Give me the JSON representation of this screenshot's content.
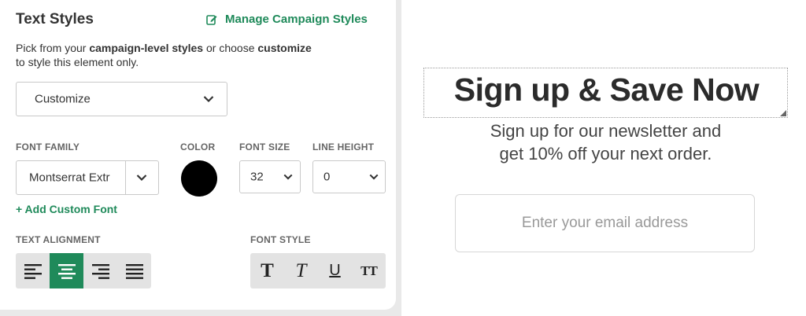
{
  "panel": {
    "title": "Text Styles",
    "manage_link": "Manage Campaign Styles",
    "description_parts": [
      "Pick from your ",
      "campaign-level styles",
      " or choose ",
      "customize",
      " to style this element only."
    ],
    "style_select": {
      "value": "Customize"
    },
    "labels": {
      "font_family": "FONT FAMILY",
      "color": "COLOR",
      "font_size": "FONT SIZE",
      "line_height": "LINE HEIGHT",
      "text_alignment": "TEXT ALIGNMENT",
      "font_style": "FONT STYLE"
    },
    "font_family_value": "Montserrat Extr",
    "color_value": "#000000",
    "font_size_value": "32",
    "line_height_value": "0",
    "add_font": "+ Add Custom Font",
    "alignment_options": [
      "align-left",
      "align-center",
      "align-right",
      "align-justify"
    ],
    "alignment_selected": "align-center",
    "font_style_options": [
      "bold",
      "italic",
      "underline",
      "uppercase"
    ],
    "accent_color": "#1f8a5a"
  },
  "preview": {
    "headline": "Sign up & Save Now",
    "subtext_line1": "Sign up for our newsletter and",
    "subtext_line2": "get 10% off your next order.",
    "email_placeholder": "Enter your email address"
  }
}
